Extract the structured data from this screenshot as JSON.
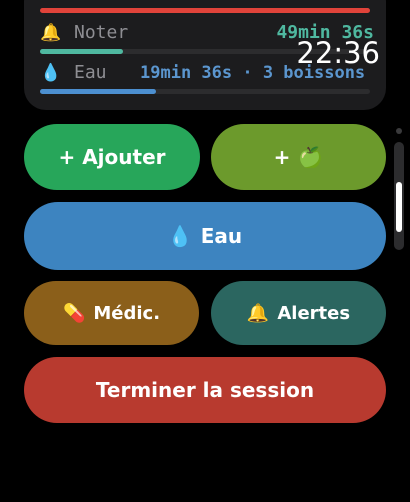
{
  "clock": "22:36",
  "status": {
    "noter": {
      "icon": "🔔",
      "label": "Noter",
      "value": "49min 36s",
      "progress": 0.25
    },
    "eau": {
      "icon": "💧",
      "label": "Eau",
      "value": "19min 36s · 3 boissons",
      "progress": 0.35
    }
  },
  "buttons": {
    "ajouter": "+ Ajouter",
    "pomme_plus": "+",
    "pomme_icon": "🍏",
    "eau_icon": "💧",
    "eau": "Eau",
    "medic_icon": "💊",
    "medic": "Médic.",
    "alertes_icon": "🔔",
    "alertes": "Alertes",
    "terminer": "Terminer la session"
  },
  "colors": {
    "ajouter": "#27a65a",
    "pomme": "#6c9a2c",
    "eau": "#3d84c0",
    "medic": "#8b5f1a",
    "alertes": "#2b6660",
    "terminer": "#b83a2f",
    "noter_accent": "#4fb8a0",
    "eau_accent": "#5b96cf"
  },
  "icons": {
    "noter": "bell-icon",
    "eau": "water-drop-icon",
    "pomme": "green-apple-icon",
    "medic": "pill-icon",
    "alertes": "bell-icon"
  }
}
